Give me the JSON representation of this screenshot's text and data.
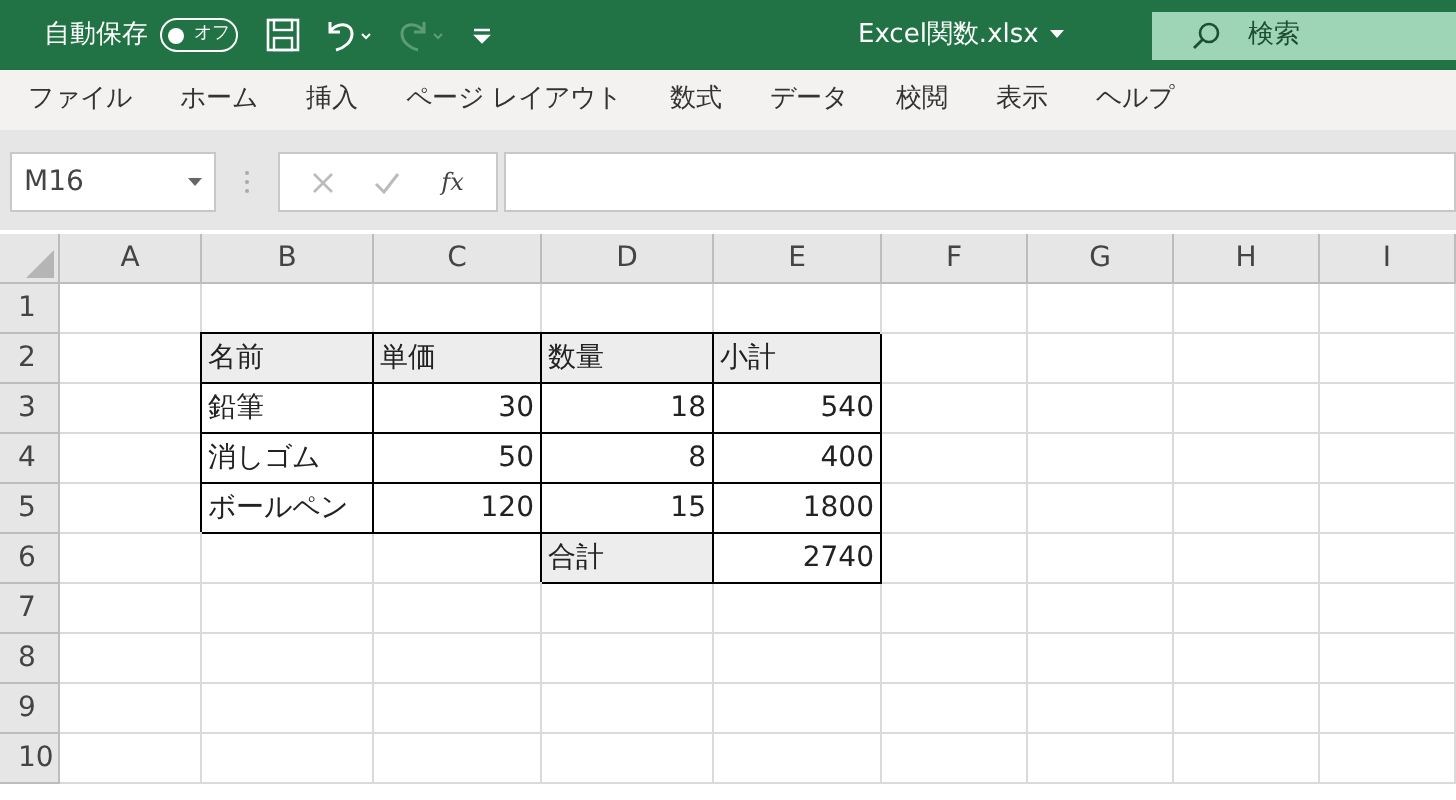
{
  "title_bar": {
    "autosave_label": "自動保存",
    "autosave_toggle": {
      "label": "オフ",
      "on": false
    },
    "redo_disabled": true,
    "file_name": "Excel関数.xlsx",
    "search": {
      "placeholder": "検索"
    }
  },
  "ribbon_tabs": [
    {
      "label": "ファイル",
      "selected": false
    },
    {
      "label": "ホーム",
      "selected": false
    },
    {
      "label": "挿入",
      "selected": false
    },
    {
      "label": "ページ レイアウト",
      "selected": false
    },
    {
      "label": "数式",
      "selected": false
    },
    {
      "label": "データ",
      "selected": false
    },
    {
      "label": "校閲",
      "selected": false
    },
    {
      "label": "表示",
      "selected": false
    },
    {
      "label": "ヘルプ",
      "selected": false
    }
  ],
  "formula_bar": {
    "name_box": "M16",
    "fx_label": "fx"
  },
  "sheet": {
    "columns": [
      "A",
      "B",
      "C",
      "D",
      "E",
      "F",
      "G",
      "H",
      "I"
    ],
    "rows": [
      {
        "number": "1",
        "cells": []
      },
      {
        "number": "2",
        "cells": [
          {
            "kind": "blank"
          },
          {
            "kind": "label",
            "text": "名前",
            "shaded": true
          },
          {
            "kind": "label",
            "text": "単価",
            "shaded": true
          },
          {
            "kind": "label",
            "text": "数量",
            "shaded": true
          },
          {
            "kind": "label",
            "text": "小計",
            "shaded": true
          }
        ]
      },
      {
        "number": "3",
        "cells": [
          {
            "kind": "blank"
          },
          {
            "kind": "label",
            "text": "鉛筆",
            "shaded": false
          },
          {
            "kind": "number",
            "text": "30",
            "shaded": false
          },
          {
            "kind": "number",
            "text": "18",
            "shaded": false
          },
          {
            "kind": "number",
            "text": "540",
            "shaded": false
          }
        ]
      },
      {
        "number": "4",
        "cells": [
          {
            "kind": "blank"
          },
          {
            "kind": "label",
            "text": "消しゴム",
            "shaded": false
          },
          {
            "kind": "number",
            "text": "50",
            "shaded": false
          },
          {
            "kind": "number",
            "text": "8",
            "shaded": false
          },
          {
            "kind": "number",
            "text": "400",
            "shaded": false
          }
        ]
      },
      {
        "number": "5",
        "cells": [
          {
            "kind": "blank"
          },
          {
            "kind": "label",
            "text": "ボールペン",
            "shaded": false
          },
          {
            "kind": "number",
            "text": "120",
            "shaded": false
          },
          {
            "kind": "number",
            "text": "15",
            "shaded": false
          },
          {
            "kind": "number",
            "text": "1800",
            "shaded": false
          }
        ]
      },
      {
        "number": "6",
        "cells": [
          {
            "kind": "blank"
          },
          {
            "kind": "blank"
          },
          {
            "kind": "blank"
          },
          {
            "kind": "label",
            "text": "合計",
            "shaded": true
          },
          {
            "kind": "number",
            "text": "2740",
            "shaded": false
          }
        ]
      },
      {
        "number": "7",
        "cells": []
      },
      {
        "number": "8",
        "cells": []
      },
      {
        "number": "9",
        "cells": []
      },
      {
        "number": "10",
        "cells": []
      }
    ]
  }
}
